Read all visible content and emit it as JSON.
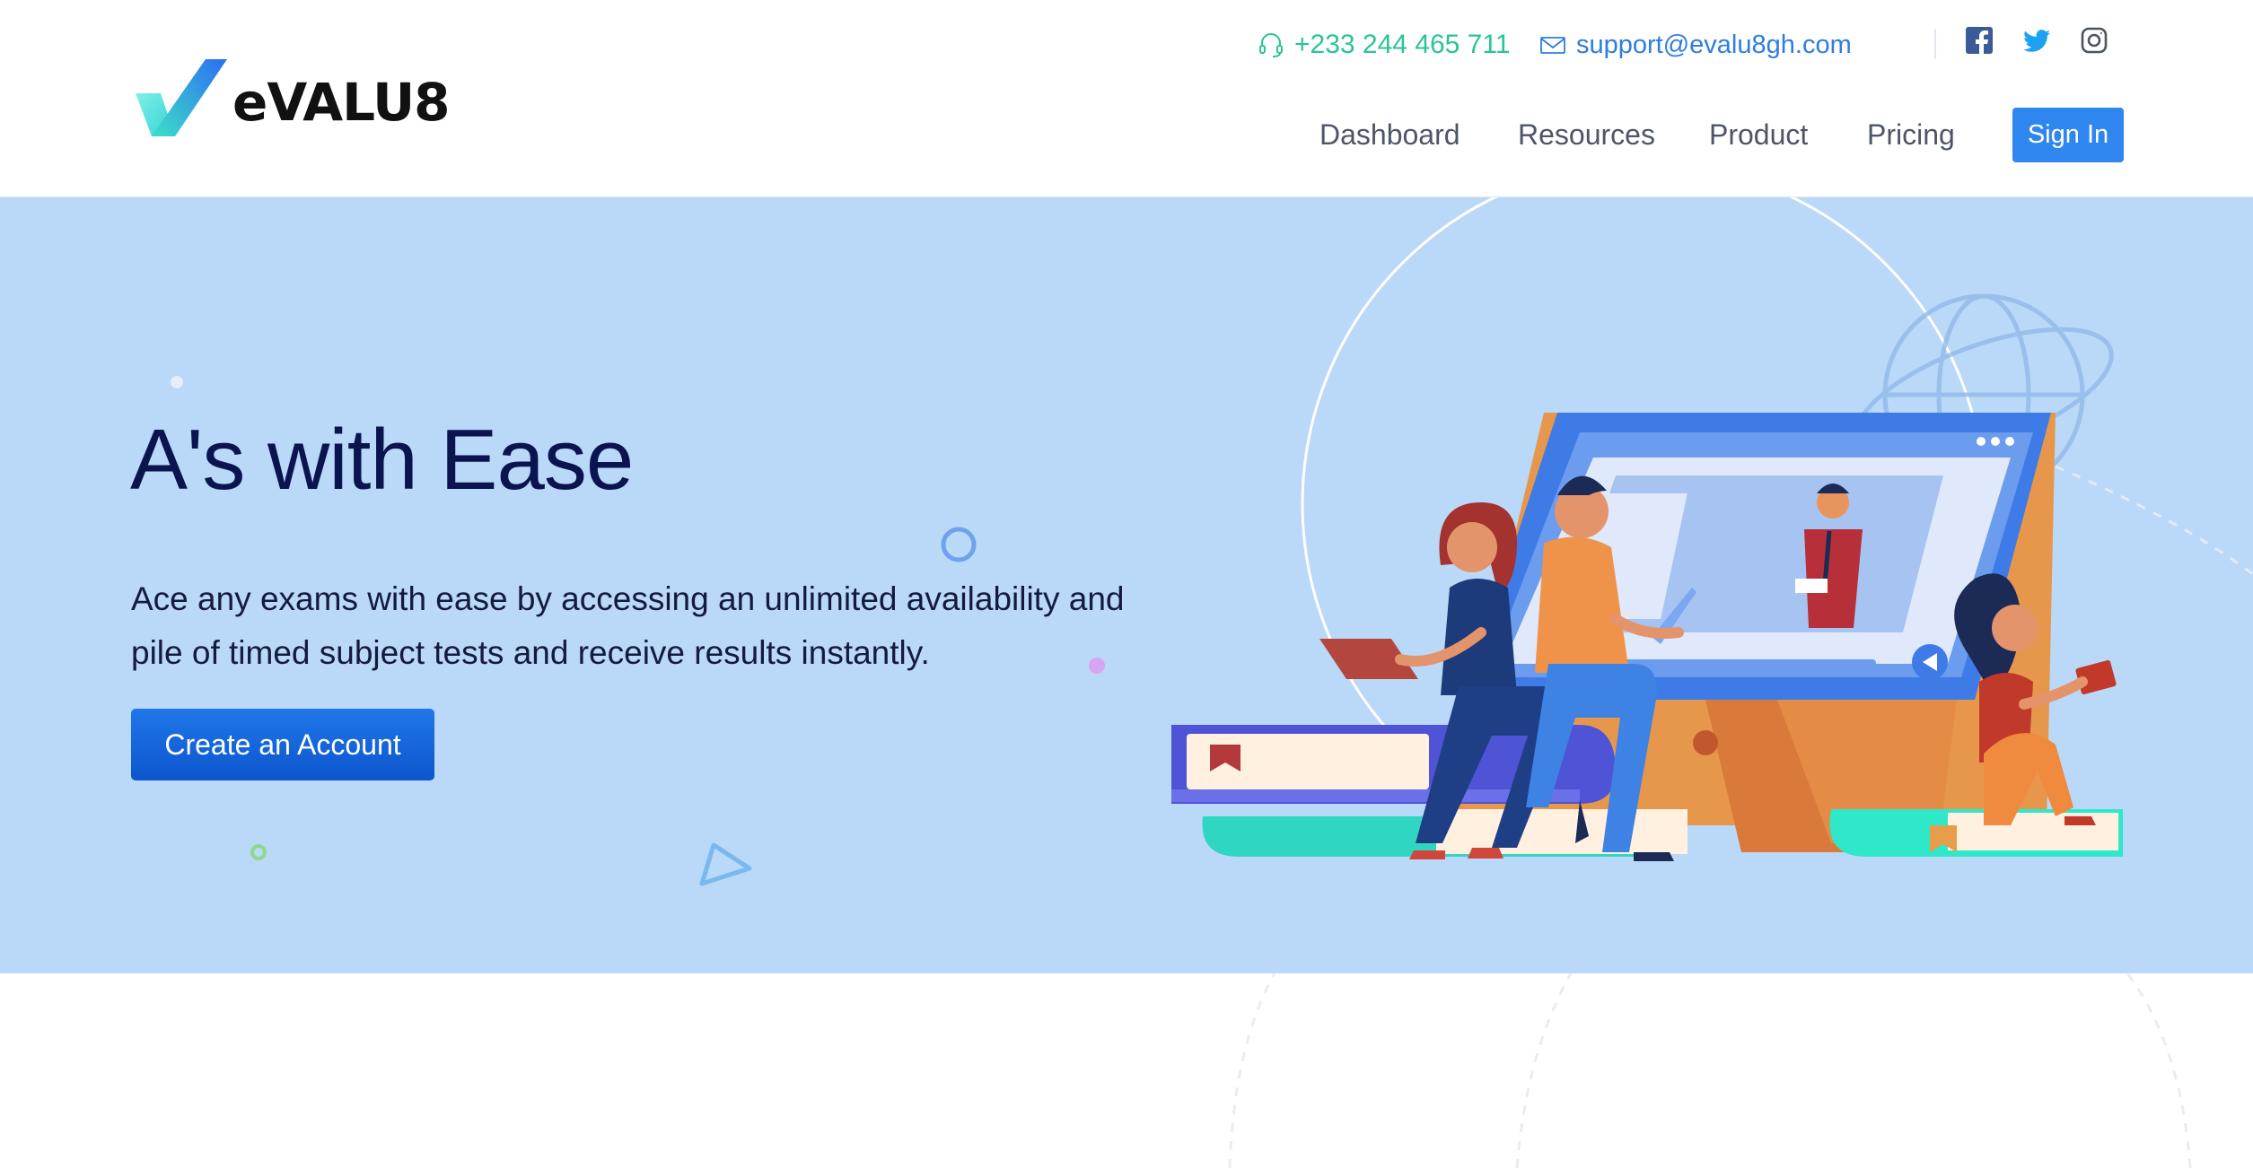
{
  "brand": {
    "name": "eVALU8"
  },
  "contact": {
    "phone": "+233 244 465 711",
    "email": "support@evalu8gh.com"
  },
  "nav": {
    "dashboard": "Dashboard",
    "resources": "Resources",
    "product": "Product",
    "pricing": "Pricing",
    "sign_in": "Sign In"
  },
  "hero": {
    "title": "A's with Ease",
    "text": "Ace any exams with ease by accessing an unlimited availability and pile of timed subject tests and receive results instantly.",
    "cta": "Create an Account"
  },
  "icons": {
    "phone": "headset-icon",
    "email": "envelope-icon",
    "social": [
      "facebook-icon",
      "twitter-icon",
      "instagram-icon"
    ]
  },
  "colors": {
    "hero_background": "#bad8f8",
    "primary": "#2f86ee",
    "phone_text": "#2bc29a",
    "email_text": "#2f7de1",
    "heading": "#0c1450"
  }
}
